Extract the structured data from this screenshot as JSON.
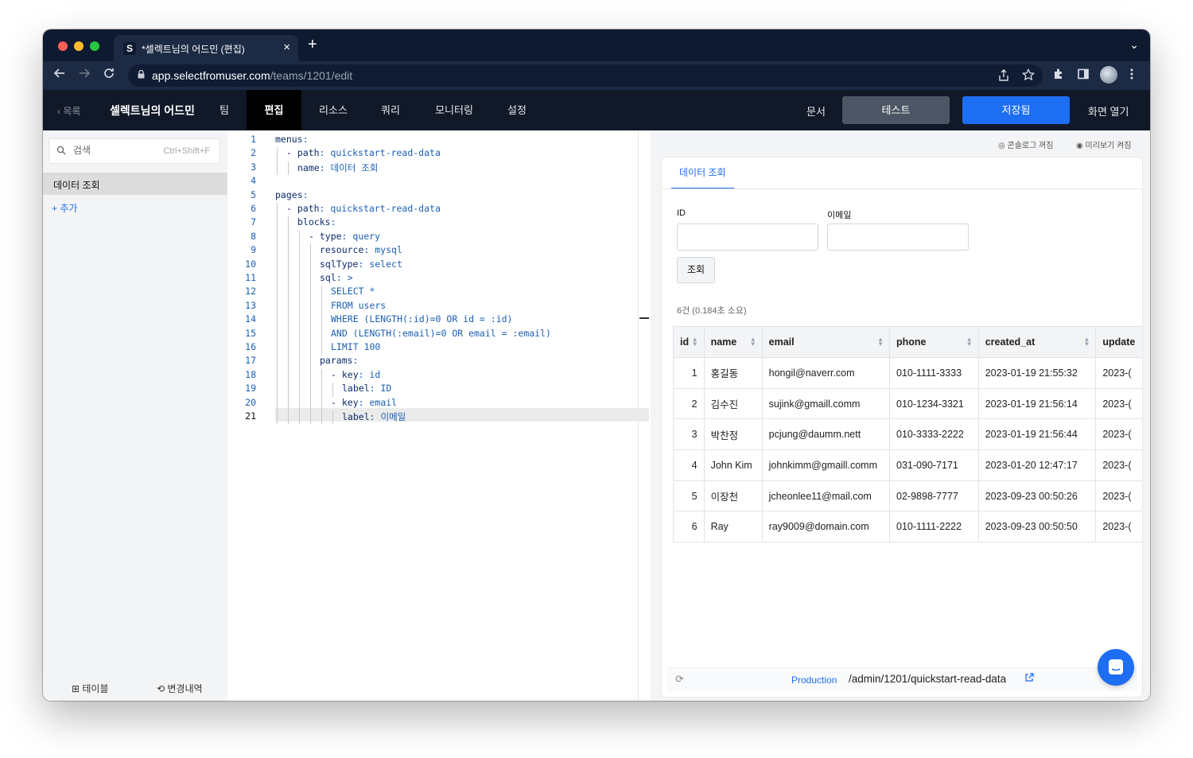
{
  "browser": {
    "tab_favicon": "S",
    "tab_title": "*셀렉트님의 어드민 (편집)",
    "tab_close": "×",
    "new_tab": "+",
    "tabs_dropdown": "⌄",
    "url_host": "app.selectfromuser.com",
    "url_path": "/teams/1201/edit",
    "icons": [
      "back-arrow-icon",
      "forward-arrow-icon",
      "reload-icon",
      "lock-icon",
      "share-icon",
      "star-icon",
      "extensions-icon",
      "sidepanel-icon",
      "profile-avatar",
      "kebab-menu-icon"
    ]
  },
  "header": {
    "back_label": "‹  목록",
    "app_title": "셀렉트님의 어드민",
    "nav": [
      {
        "label": "팀",
        "active": false
      },
      {
        "label": "편집",
        "active": true
      },
      {
        "label": "리소스",
        "active": false
      },
      {
        "label": "쿼리",
        "active": false
      },
      {
        "label": "모니터링",
        "active": false
      },
      {
        "label": "설정",
        "active": false
      }
    ],
    "docs_label": "문서",
    "test_label": "테스트",
    "save_label": "저장됨",
    "open_label": "화면 열기"
  },
  "sidebar": {
    "search_placeholder": "검색",
    "search_shortcut": "Ctrl+Shift+F",
    "items": [
      {
        "label": "데이터 조회",
        "selected": true
      }
    ],
    "add_label": "+  추가",
    "footer_table": "⊞ 테이블",
    "footer_history": "⟲ 변경내역"
  },
  "editor": {
    "line_numbers": [
      "1",
      "2",
      "3",
      "4",
      "5",
      "6",
      "7",
      "8",
      "9",
      "10",
      "11",
      "12",
      "13",
      "14",
      "15",
      "16",
      "17",
      "18",
      "19",
      "20",
      "21"
    ],
    "lines": [
      {
        "indent": 0,
        "key": "menus",
        "sep": ":",
        "val": ""
      },
      {
        "indent": 1,
        "key": "- path",
        "sep": ":",
        "val": " quickstart-read-data"
      },
      {
        "indent": 2,
        "key": "name",
        "sep": ":",
        "val": " 데이터 조회"
      },
      {
        "indent": 0,
        "key": "",
        "sep": "",
        "val": ""
      },
      {
        "indent": 0,
        "key": "pages",
        "sep": ":",
        "val": ""
      },
      {
        "indent": 1,
        "key": "- path",
        "sep": ":",
        "val": " quickstart-read-data"
      },
      {
        "indent": 2,
        "key": "blocks",
        "sep": ":",
        "val": ""
      },
      {
        "indent": 3,
        "key": "- type",
        "sep": ":",
        "val": " query"
      },
      {
        "indent": 4,
        "key": "resource",
        "sep": ":",
        "val": " mysql"
      },
      {
        "indent": 4,
        "key": "sqlType",
        "sep": ":",
        "val": " select"
      },
      {
        "indent": 4,
        "key": "sql",
        "sep": ":",
        "val": " >"
      },
      {
        "indent": 5,
        "key": "",
        "sep": "",
        "val": "SELECT *"
      },
      {
        "indent": 5,
        "key": "",
        "sep": "",
        "val": "FROM users"
      },
      {
        "indent": 5,
        "key": "",
        "sep": "",
        "val": "WHERE (LENGTH(:id)=0 OR id = :id)"
      },
      {
        "indent": 5,
        "key": "",
        "sep": "",
        "val": "AND (LENGTH(:email)=0 OR email = :email)"
      },
      {
        "indent": 5,
        "key": "",
        "sep": "",
        "val": "LIMIT 100"
      },
      {
        "indent": 4,
        "key": "params",
        "sep": ":",
        "val": ""
      },
      {
        "indent": 5,
        "key": "- key",
        "sep": ":",
        "val": " id"
      },
      {
        "indent": 6,
        "key": "label",
        "sep": ":",
        "val": " ID"
      },
      {
        "indent": 5,
        "key": "- key",
        "sep": ":",
        "val": " email"
      },
      {
        "indent": 6,
        "key": "label",
        "sep": ":",
        "val": " 이메일"
      }
    ],
    "current_line": 21
  },
  "preview": {
    "console_toggle": "◎ 콘솔로그 꺼짐",
    "preview_toggle": "◉ 미리보기 켜짐",
    "tab_label": "데이터 조회",
    "field_id_label": "ID",
    "field_email_label": "이메일",
    "query_button": "조회",
    "result_info": "6건 (0.184초 소요)",
    "columns": [
      "id",
      "name",
      "email",
      "phone",
      "created_at",
      "update"
    ],
    "rows": [
      [
        "1",
        "홍길동",
        "hongil@naverr.com",
        "010-1111-3333",
        "2023-01-19 21:55:32",
        "2023-("
      ],
      [
        "2",
        "김수진",
        "sujink@gmaill.comm",
        "010-1234-3321",
        "2023-01-19 21:56:14",
        "2023-("
      ],
      [
        "3",
        "박찬정",
        "pcjung@daumm.nett",
        "010-3333-2222",
        "2023-01-19 21:56:44",
        "2023-("
      ],
      [
        "4",
        "John Kim",
        "johnkimm@gmaill.comm",
        "031-090-7171",
        "2023-01-20 12:47:17",
        "2023-("
      ],
      [
        "5",
        "이장천",
        "jcheonlee11@mail.com",
        "02-9898-7777",
        "2023-09-23 00:50:26",
        "2023-("
      ],
      [
        "6",
        "Ray",
        "ray9009@domain.com",
        "010-1111-2222",
        "2023-09-23 00:50:50",
        "2023-("
      ]
    ],
    "env_label": "Production",
    "route_path": "/admin/1201/quickstart-read-data"
  },
  "colors": {
    "tabbar": "#0d1a30",
    "toolbar": "#1c2a44",
    "app_header": "#111827",
    "accent": "#1d6ef2",
    "test_button": "#4b5563"
  }
}
